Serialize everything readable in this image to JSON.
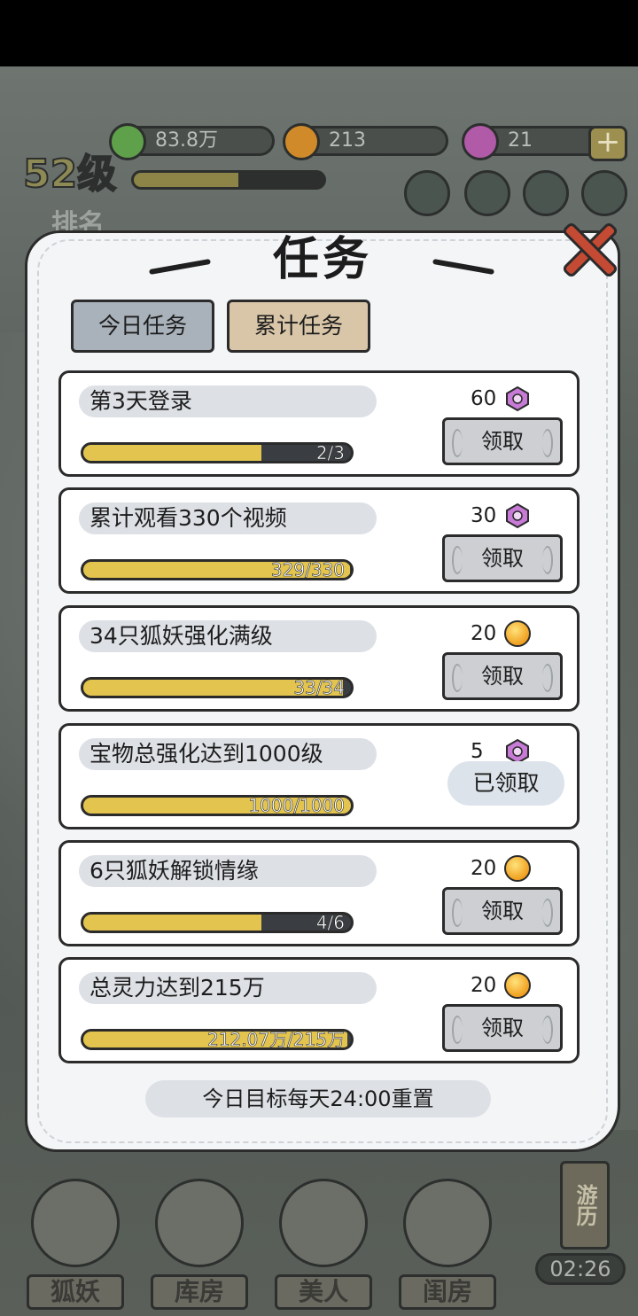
{
  "hud": {
    "level": "52级",
    "rank_label": "排名",
    "exp_progress": 0.55,
    "resources": [
      {
        "name": "spirit",
        "value": "83.8万",
        "color": "#5fa04a"
      },
      {
        "name": "coin",
        "value": "213",
        "color": "#d08a2a"
      },
      {
        "name": "gem",
        "value": "21",
        "color": "#b05aa8"
      }
    ],
    "plus_label": "+"
  },
  "modal": {
    "title": "任务",
    "tabs": [
      {
        "label": "今日任务",
        "active": false
      },
      {
        "label": "累计任务",
        "active": true
      }
    ],
    "tasks": [
      {
        "name": "第3天登录",
        "progress_text": "2/3",
        "progress": 0.667,
        "reward_amount": "60",
        "reward_icon": "purple-gem-icon",
        "button": "领取",
        "claimed": false
      },
      {
        "name": "累计观看330个视频",
        "progress_text": "329/330",
        "progress": 0.997,
        "reward_amount": "30",
        "reward_icon": "purple-gem-icon",
        "button": "领取",
        "claimed": false
      },
      {
        "name": "34只狐妖强化满级",
        "progress_text": "33/34",
        "progress": 0.97,
        "reward_amount": "20",
        "reward_icon": "gold-orb-icon",
        "button": "领取",
        "claimed": false
      },
      {
        "name": "宝物总强化达到1000级",
        "progress_text": "1000/1000",
        "progress": 1.0,
        "reward_amount": "5",
        "reward_icon": "purple-gem-icon",
        "button": "已领取",
        "claimed": true
      },
      {
        "name": "6只狐妖解锁情缘",
        "progress_text": "4/6",
        "progress": 0.667,
        "reward_amount": "20",
        "reward_icon": "gold-orb-icon",
        "button": "领取",
        "claimed": false
      },
      {
        "name": "总灵力达到215万",
        "progress_text": "212.07万/215万",
        "progress": 0.986,
        "reward_amount": "20",
        "reward_icon": "gold-orb-icon",
        "button": "领取",
        "claimed": false
      }
    ],
    "footer": "今日目标每天24:00重置"
  },
  "side": {
    "travel_label": "游历",
    "timer": "02:26"
  },
  "bottom_nav": [
    {
      "label": "狐妖"
    },
    {
      "label": "库房"
    },
    {
      "label": "美人"
    },
    {
      "label": "闺房"
    }
  ]
}
